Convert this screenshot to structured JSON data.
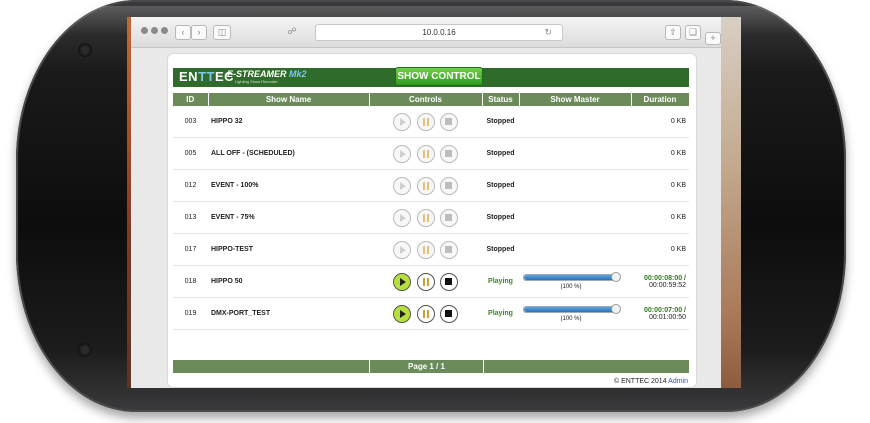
{
  "browser": {
    "address": "10.0.0.16",
    "back_icon": "chevron-left-icon",
    "forward_icon": "chevron-right-icon"
  },
  "header": {
    "logo_ent": "EN",
    "logo_tt": "TT",
    "logo_ec": "EC",
    "product": "E-STREAMER",
    "product_mk": "Mk2",
    "product_sub": "Lighting Show Recorder",
    "show_control_label": "SHOW CONTROL"
  },
  "table": {
    "columns": [
      "ID",
      "Show Name",
      "Controls",
      "Status",
      "Show Master",
      "Duration"
    ],
    "rows": [
      {
        "id": "003",
        "name": "HIPPO 32",
        "status": "Stopped",
        "active": false,
        "master": null,
        "dur1": "",
        "dur2": "0 KB"
      },
      {
        "id": "005",
        "name": "ALL OFF - (SCHEDULED)",
        "status": "Stopped",
        "active": false,
        "master": null,
        "dur1": "",
        "dur2": "0 KB"
      },
      {
        "id": "012",
        "name": "EVENT - 100%",
        "status": "Stopped",
        "active": false,
        "master": null,
        "dur1": "",
        "dur2": "0 KB"
      },
      {
        "id": "013",
        "name": "EVENT - 75%",
        "status": "Stopped",
        "active": false,
        "master": null,
        "dur1": "",
        "dur2": "0 KB"
      },
      {
        "id": "017",
        "name": "HIPPO-TEST",
        "status": "Stopped",
        "active": false,
        "master": null,
        "dur1": "",
        "dur2": "0 KB"
      },
      {
        "id": "018",
        "name": "HIPPO 50",
        "status": "Playing",
        "active": true,
        "master": {
          "level": 100,
          "label": "(100 %)"
        },
        "dur1": "00:00:08:00 /",
        "dur2": "00:00:59:52"
      },
      {
        "id": "019",
        "name": "DMX-PORT_TEST",
        "status": "Playing",
        "active": true,
        "master": {
          "level": 100,
          "label": "(100 %)"
        },
        "dur1": "00:00:07:00 /",
        "dur2": "00:01:00:50"
      }
    ]
  },
  "footer": {
    "page_label": "Page 1 / 1",
    "copyright": "© ENTTEC 2014",
    "admin_link": "Admin"
  },
  "colors": {
    "header_green": "#2f6b2a",
    "table_header": "#6b8c5a",
    "show_name": "#2f7a1e",
    "play_active": "#b6e03a"
  }
}
